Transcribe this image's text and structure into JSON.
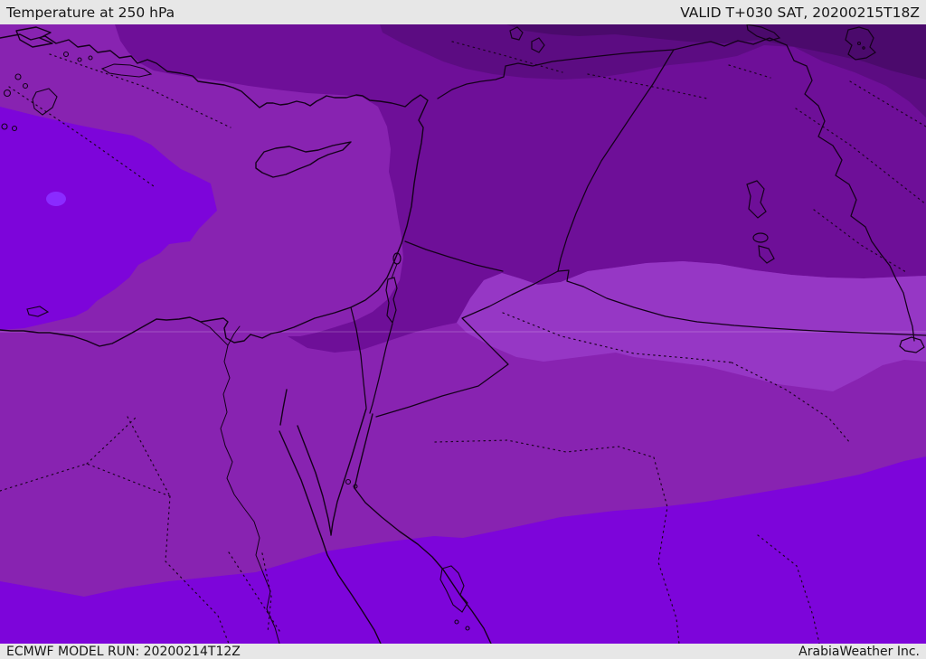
{
  "header": {
    "title": "Temperature at 250 hPa",
    "valid": "VALID T+030 SAT, 20200215T18Z"
  },
  "footer": {
    "model_run": "ECMWF MODEL RUN: 20200214T12Z",
    "brand": "ArabiaWeather Inc."
  },
  "map": {
    "colors": {
      "coldest": "#4b0a6c",
      "colder": "#5c0c82",
      "cold": "#6e0f98",
      "mild": "#8823b1",
      "warm_pocket": "#9637c5",
      "warmest": "#7d05da",
      "warmest_core": "#8a2bff",
      "gridline": "rgba(255,255,255,0.22)"
    }
  }
}
